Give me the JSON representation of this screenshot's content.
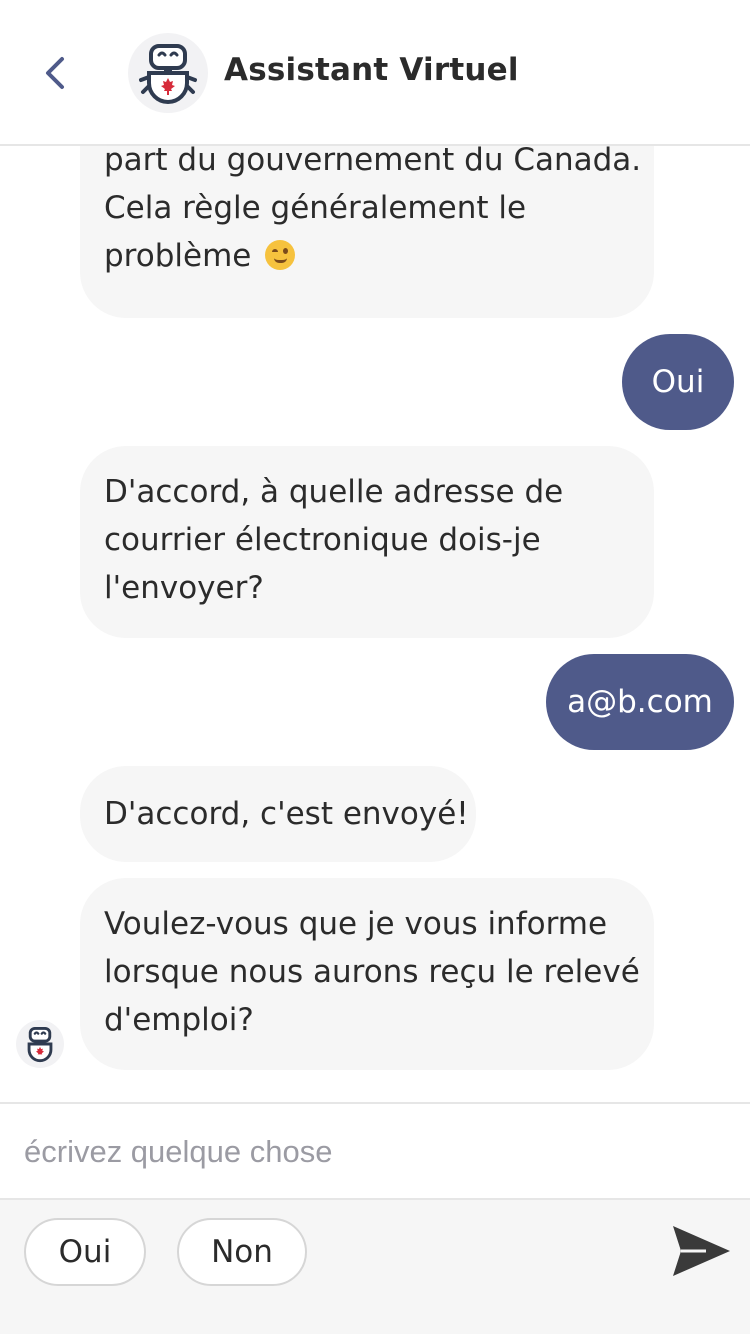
{
  "header": {
    "title": "Assistant Virtuel"
  },
  "messages": [
    {
      "from": "bot",
      "lines": [
        "part du gouvernement du Canada.",
        "Cela règle généralement le",
        "problème"
      ],
      "emoji": "wink-emoji"
    },
    {
      "from": "user",
      "text": "Oui"
    },
    {
      "from": "bot",
      "lines": [
        "D'accord, à quelle adresse de",
        "courrier électronique dois-je",
        "l'envoyer?"
      ]
    },
    {
      "from": "user",
      "text": "a@b.com"
    },
    {
      "from": "bot",
      "lines": [
        "D'accord, c'est envoyé!"
      ]
    },
    {
      "from": "bot",
      "lines": [
        "Voulez-vous que je vous informe",
        "lorsque nous aurons reçu le relevé",
        "d'emploi?"
      ]
    }
  ],
  "composer": {
    "placeholder": "écrivez quelque chose"
  },
  "quick_replies": [
    "Oui",
    "Non"
  ],
  "icons": {
    "back": "chevron-left-icon",
    "bot_avatar": "robot-maple-leaf-icon",
    "send": "send-icon"
  },
  "colors": {
    "user_bubble": "#4f5a8a",
    "bot_bubble": "#f6f6f6",
    "back_arrow": "#4f5a8a",
    "send": "#3a3a3a"
  }
}
